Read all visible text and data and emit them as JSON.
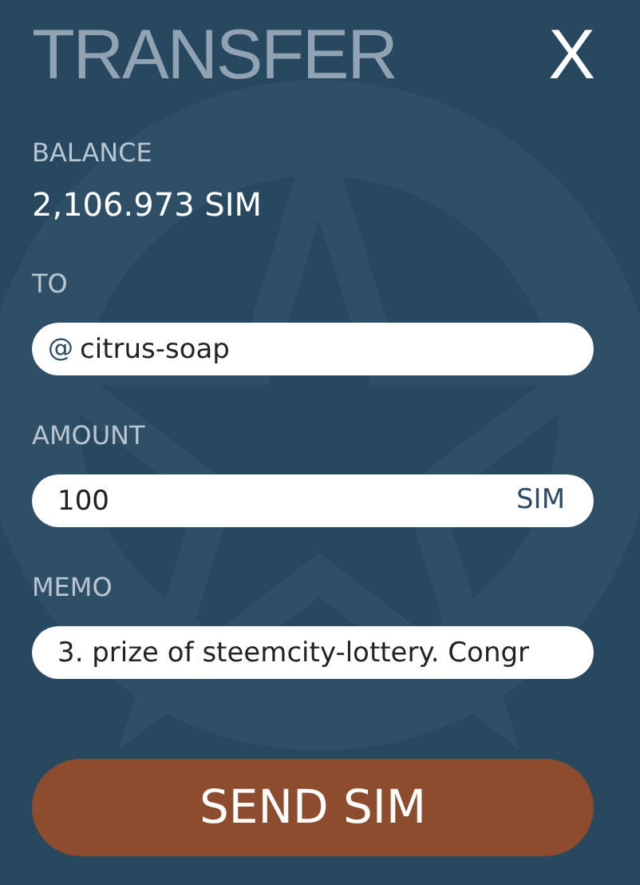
{
  "title": "TRANSFER",
  "close": {
    "label": "X"
  },
  "balance": {
    "label": "BALANCE",
    "value": "2,106.973 SIM"
  },
  "fields": [
    {
      "kind": "recipient",
      "label": "TO",
      "prefix": "@",
      "value": "citrus-soap"
    },
    {
      "kind": "amount",
      "label": "AMOUNT",
      "value": "100",
      "suffix": "SIM"
    },
    {
      "kind": "memo",
      "label": "MEMO",
      "value": "3. prize of steemcity-lottery. Congr"
    }
  ],
  "submit": {
    "label": "SEND SIM"
  }
}
